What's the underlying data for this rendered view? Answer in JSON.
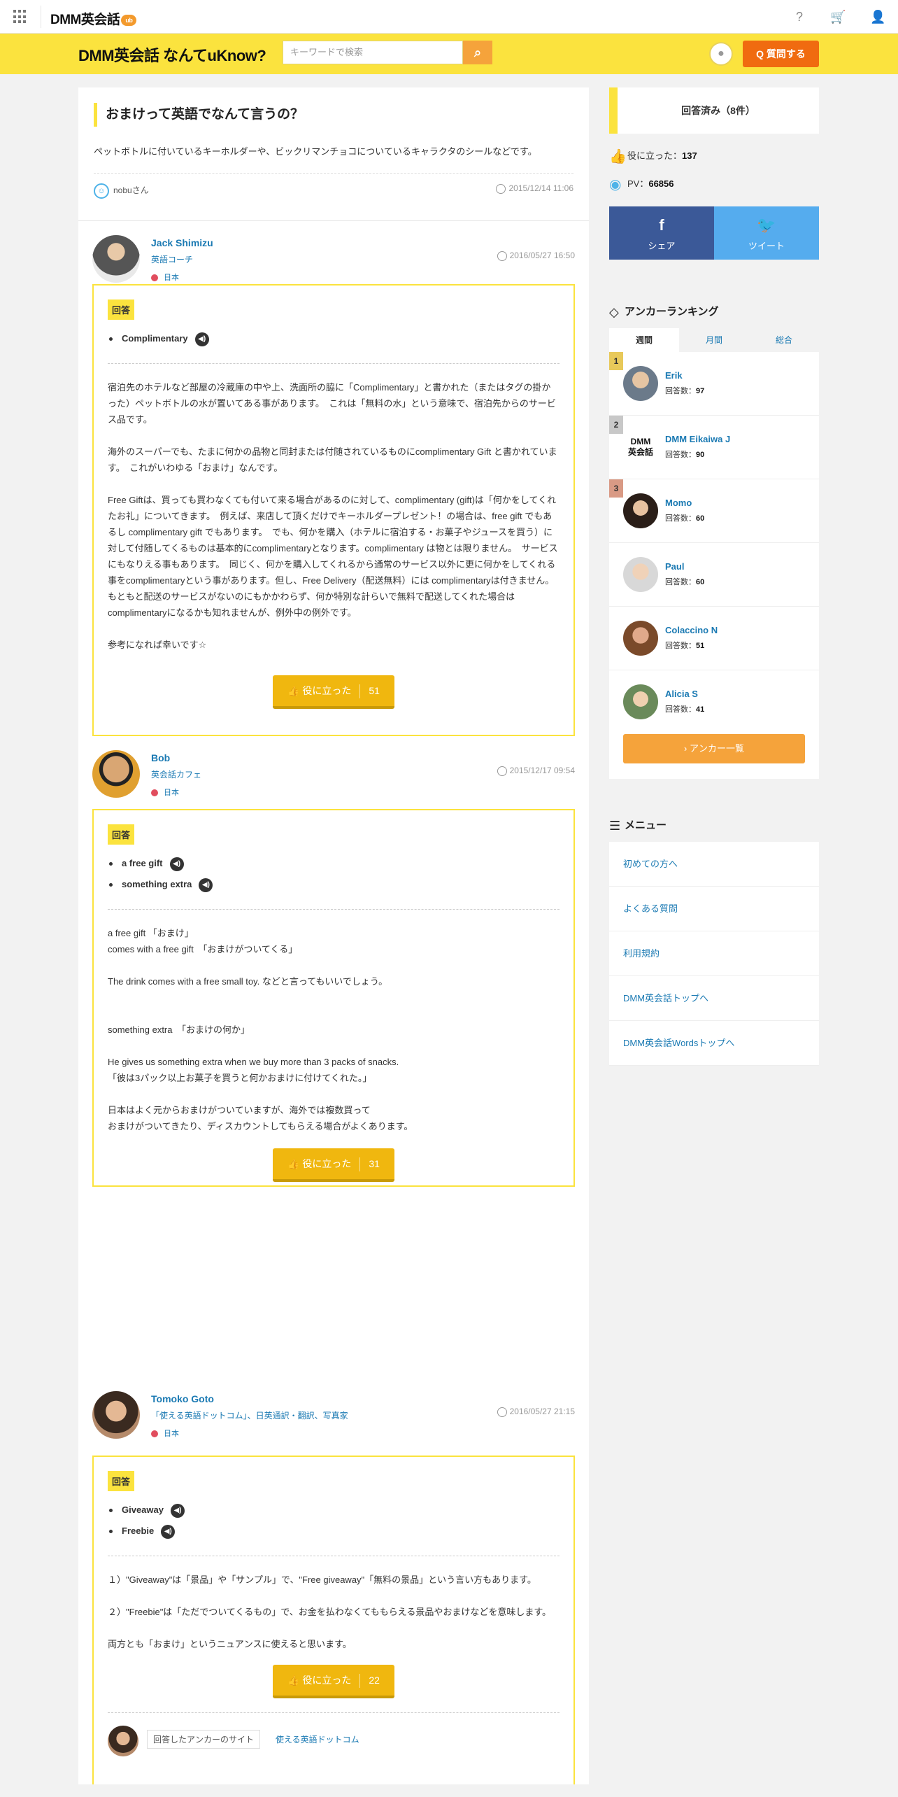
{
  "topbar": {
    "brand": "DMM英会話",
    "badge": "ub"
  },
  "header": {
    "logo": "DMM英会話 なんてuKnow?",
    "search_placeholder": "キーワードで検索",
    "ask_label": "質問する"
  },
  "question": {
    "title": "おまけって英語でなんて言うの？",
    "body": "ペットボトルに付いているキーホルダーや、ビックリマンチョコについているキャラクタのシールなどです。",
    "author": "nobuさん",
    "time": "2015/12/14 11:06"
  },
  "answers": [
    {
      "name": "Jack Shimizu",
      "title": "英語コーチ",
      "country": "日本",
      "time": "2016/05/27 16:50",
      "tag": "回答",
      "phrases": [
        "Complimentary"
      ],
      "body": "宿泊先のホテルなど部屋の冷蔵庫の中や上、洗面所の脇に「Complimentary」と書かれた（またはタグの掛かった）ペットボトルの水が置いてある事があります。　これは「無料の水」という意味で、宿泊先からのサービス品です。\n\n海外のスーパーでも、たまに何かの品物と同封または付随されているものにcomplimentary Gift と書かれています。　これがいわゆる「おまけ」なんです。\n\nFree Giftは、買っても買わなくても付いて来る場合があるのに対して、complimentary (gift)は「何かをしてくれたお礼」についてきます。　例えば、来店して頂くだけでキーホルダープレゼント！の場合は、free gift でもあるし complimentary gift でもあります。　でも、何かを購入（ホテルに宿泊する・お菓子やジュースを買う）に対して付随してくるものは基本的にcomplimentaryとなります。complimentary は物とは限りません。　サービスにもなりえる事もあります。　同じく、何かを購入してくれるから通常のサービス以外に更に何かをしてくれる事をcomplimentaryという事があります。但し、Free Delivery（配送無料）には complimentaryは付きません。　もともと配送のサービスがないのにもかかわらず、何か特別な計らいで無料で配送してくれた場合はcomplimentaryになるかも知れませんが、例外中の例外です。\n\n参考になれば幸いです☆",
      "helpful_label": "役に立った",
      "helpful_count": "51"
    },
    {
      "name": "Bob",
      "title": "英会話カフェ",
      "country": "日本",
      "time": "2015/12/17 09:54",
      "tag": "回答",
      "phrases": [
        "a free gift",
        "something extra"
      ],
      "body": "a free gift 「おまけ」\ncomes with a free gift　「おまけがついてくる」\n\nThe drink comes with a free small toy. などと言ってもいいでしょう。\n\n\nsomething extra　「おまけの何か」\n\nHe gives us something extra when we buy more than 3 packs of snacks.\n「彼は3パック以上お菓子を買うと何かおまけに付けてくれた。」\n\n日本はよく元からおまけがついていますが、海外では複数買って\nおまけがついてきたり、ディスカウントしてもらえる場合がよくあります。",
      "helpful_label": "役に立った",
      "helpful_count": "31"
    },
    {
      "name": "Tomoko Goto",
      "title": "「使える英語ドットコム」、日英通訳・翻訳、写真家",
      "country": "日本",
      "time": "2016/05/27 21:15",
      "tag": "回答",
      "phrases": [
        "Giveaway",
        "Freebie"
      ],
      "body": "１）\"Giveaway\"は「景品」や「サンプル」で、\"Free giveaway\"「無料の景品」という言い方もあります。\n\n２）\"Freebie\"は「ただでついてくるもの」で、お金を払わなくてももらえる景品やおまけなどを意味します。\n\n両方とも「おまけ」というニュアンスに使えると思います。",
      "helpful_label": "役に立った",
      "helpful_count": "22",
      "site_label": "回答したアンカーのサイト",
      "site_link": "使える英語ドットコム"
    }
  ],
  "sidebar": {
    "answered": "回答済み（8件）",
    "helpful_label": "役に立った：",
    "helpful_value": "137",
    "pv_label": "PV：",
    "pv_value": "66856",
    "share_fb": "シェア",
    "share_tw": "ツイート",
    "ranking_title": "アンカーランキング",
    "tabs": [
      "週間",
      "月間",
      "総合"
    ],
    "ranking": [
      {
        "rank": "1",
        "name": "Erik",
        "count_label": "回答数：",
        "count": "97"
      },
      {
        "rank": "2",
        "name": "DMM Eikaiwa J",
        "count_label": "回答数：",
        "count": "90"
      },
      {
        "rank": "3",
        "name": "Momo",
        "count_label": "回答数：",
        "count": "60"
      },
      {
        "rank": "",
        "name": "Paul",
        "count_label": "回答数：",
        "count": "60"
      },
      {
        "rank": "",
        "name": "Colaccino N",
        "count_label": "回答数：",
        "count": "51"
      },
      {
        "rank": "",
        "name": "Alicia S",
        "count_label": "回答数：",
        "count": "41"
      }
    ],
    "more_label": "アンカー一覧",
    "menu_title": "メニュー",
    "menu": [
      "初めての方へ",
      "よくある質問",
      "利用規約",
      "DMM英会話トップへ",
      "DMM英会話Wordsトップへ"
    ]
  },
  "colors": {
    "yellow": "#fbe33e",
    "orange": "#f06b10",
    "link": "#1b7ab3",
    "helpful": "#f0b70f"
  }
}
